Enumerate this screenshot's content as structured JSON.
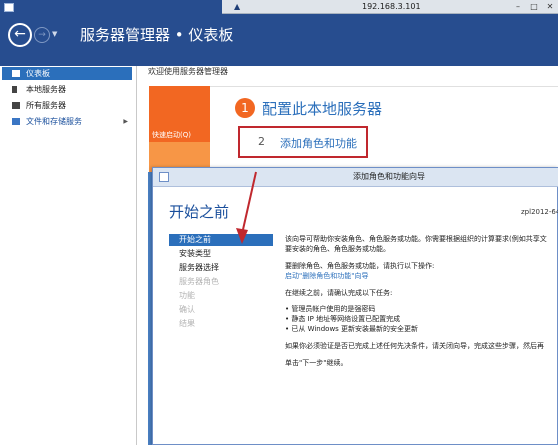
{
  "remote_bar": {
    "ip": "192.168.3.101"
  },
  "app": {
    "title": "服务器管理器 • 仪表板"
  },
  "sidebar": {
    "items": [
      {
        "label": "仪表板",
        "active": true
      },
      {
        "label": "本地服务器",
        "active": false
      },
      {
        "label": "所有服务器",
        "active": false
      },
      {
        "label": "文件和存储服务",
        "active": false
      }
    ]
  },
  "content": {
    "welcome": "欢迎使用服务器管理器",
    "quick_start_label": "快速启动(Q)",
    "step1_number": "1",
    "step1_text": "配置此本地服务器",
    "step2_number": "2",
    "step2_text": "添加角色和功能"
  },
  "wizard": {
    "title": "添加角色和功能向导",
    "heading": "开始之前",
    "server_name": "zpl2012-64",
    "nav": [
      {
        "label": "开始之前",
        "state": "active"
      },
      {
        "label": "安装类型",
        "state": "normal"
      },
      {
        "label": "服务器选择",
        "state": "normal"
      },
      {
        "label": "服务器角色",
        "state": "disabled"
      },
      {
        "label": "功能",
        "state": "disabled"
      },
      {
        "label": "确认",
        "state": "disabled"
      },
      {
        "label": "结果",
        "state": "disabled"
      }
    ],
    "body": {
      "p1a": "该向导可帮助你安装角色、角色服务或功能。你需要根据组织的计算要求(例如共享文",
      "p1b": "要安装的角色、角色服务或功能。",
      "p2a": "要删除角色、角色服务或功能，请执行以下操作:",
      "p2_link": "启动\"删除角色和功能\"向导",
      "p3": "在继续之前，请确认完成以下任务:",
      "tasks": [
        "• 管理员帐户使用的是强密码",
        "• 静态 IP 地址等网络设置已配置完成",
        "• 已从 Windows 更新安装最新的安全更新"
      ],
      "p4": "如果你必须验证是否已完成上述任何先决条件，请关闭向导，完成这些步骤，然后再",
      "p5": "单击\"下一步\"继续。"
    }
  },
  "colors": {
    "titlebar": "#274d8f",
    "accent_blue": "#2b6fbb",
    "orange": "#f26722",
    "highlight_red": "#c0282e"
  }
}
